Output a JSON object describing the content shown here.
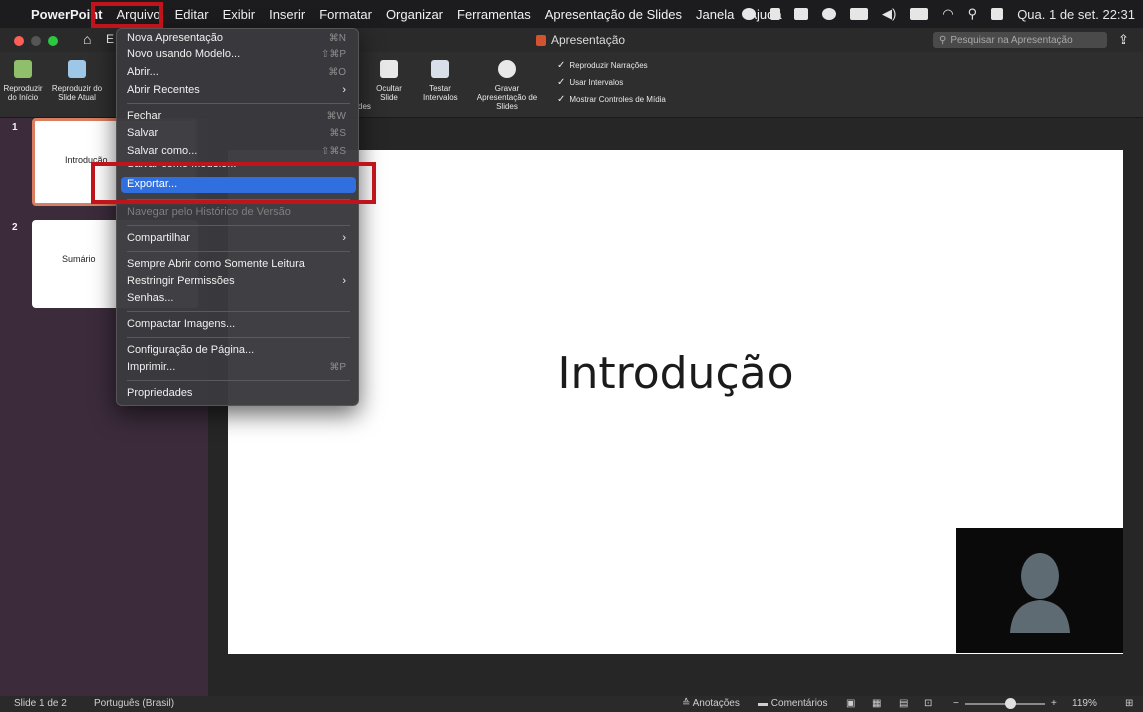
{
  "menubar": {
    "apple": "",
    "app_name": "PowerPoint",
    "items": [
      "Arquivo",
      "Editar",
      "Exibir",
      "Inserir",
      "Formatar",
      "Organizar",
      "Ferramentas",
      "Apresentação de Slides",
      "Janela",
      "Ajuda"
    ],
    "clock": "Qua. 1 de set.  22:31"
  },
  "window": {
    "doc_title": "Apresentação",
    "search_placeholder": "Pesquisar na Apresentação"
  },
  "ribbon": {
    "btn_play_start": "Reproduzir do Início",
    "btn_play_current": "Reproduzir do Slide Atual",
    "btn_hide_slide": "Ocultar Slide",
    "btn_test_timings": "Testar Intervalos",
    "btn_record": "Gravar Apresentação de Slides",
    "partial_label": "des",
    "check_narrations": "Reproduzir Narrações",
    "check_timings": "Usar Intervalos",
    "check_media": "Mostrar Controles de Mídia"
  },
  "thumbnails": [
    {
      "num": "1",
      "text": "Introdução"
    },
    {
      "num": "2",
      "text": "Sumário"
    }
  ],
  "slide": {
    "title": "Introdução"
  },
  "file_menu": {
    "new": "Nova Apresentação",
    "new_sc": "⌘N",
    "new_template": "Novo usando Modelo...",
    "new_template_sc": "⇧⌘P",
    "open": "Abrir...",
    "open_sc": "⌘O",
    "recent": "Abrir Recentes",
    "close": "Fechar",
    "close_sc": "⌘W",
    "save": "Salvar",
    "save_sc": "⌘S",
    "save_as": "Salvar como...",
    "save_as_sc": "⇧⌘S",
    "save_template": "Salvar como Modelo...",
    "export": "Exportar...",
    "history": "Navegar pelo Histórico de Versão",
    "share": "Compartilhar",
    "read_only": "Sempre Abrir como Somente Leitura",
    "restrict": "Restringir Permissões",
    "passwords": "Senhas...",
    "compress": "Compactar Imagens...",
    "page_setup": "Configuração de Página...",
    "print": "Imprimir...",
    "print_sc": "⌘P",
    "properties": "Propriedades"
  },
  "statusbar": {
    "slide_info": "Slide 1 de 2",
    "language": "Português (Brasil)",
    "notes": "Anotações",
    "comments": "Comentários",
    "zoom": "119%",
    "zoom_level_percent": 119
  },
  "colors": {
    "highlight": "#2f6fe0",
    "annotation_red": "#c0141c",
    "thumb_selected": "#d97e60",
    "thumb_pane": "#3b2b3b"
  }
}
